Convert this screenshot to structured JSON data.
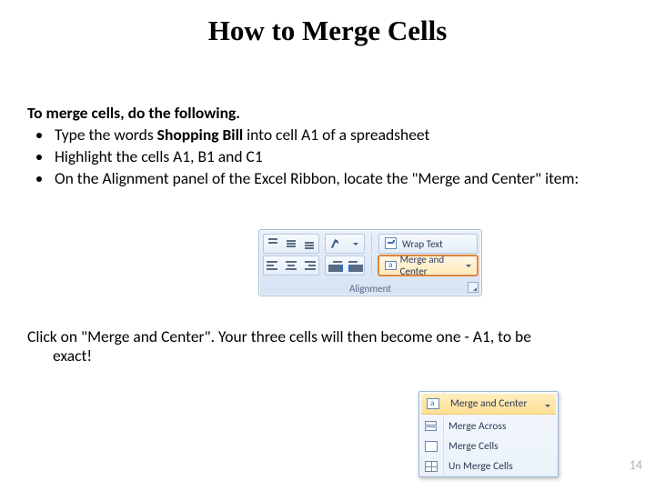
{
  "title": "How to Merge Cells",
  "intro": "To merge cells, do the following.",
  "bullets": [
    {
      "pre": "Type the words ",
      "bold": "Shopping Bill",
      "post": " into cell A1 of a spreadsheet"
    },
    {
      "pre": "Highlight the cells A1, B1 and C1",
      "bold": "",
      "post": ""
    },
    {
      "pre": "On the Alignment panel of the Excel Ribbon, locate the \"Merge and Center\" item:",
      "bold": "",
      "post": ""
    }
  ],
  "ribbon": {
    "wrap_text": "Wrap Text",
    "merge_center": "Merge and Center",
    "caption": "Alignment"
  },
  "closing_line1": "Click on \"Merge and Center\". Your three cells will then become one - A1, to be",
  "closing_line2": "exact!",
  "merge_menu": {
    "items": [
      "Merge and Center",
      "Merge Across",
      "Merge Cells",
      "Un Merge Cells"
    ]
  },
  "page_number": "14"
}
